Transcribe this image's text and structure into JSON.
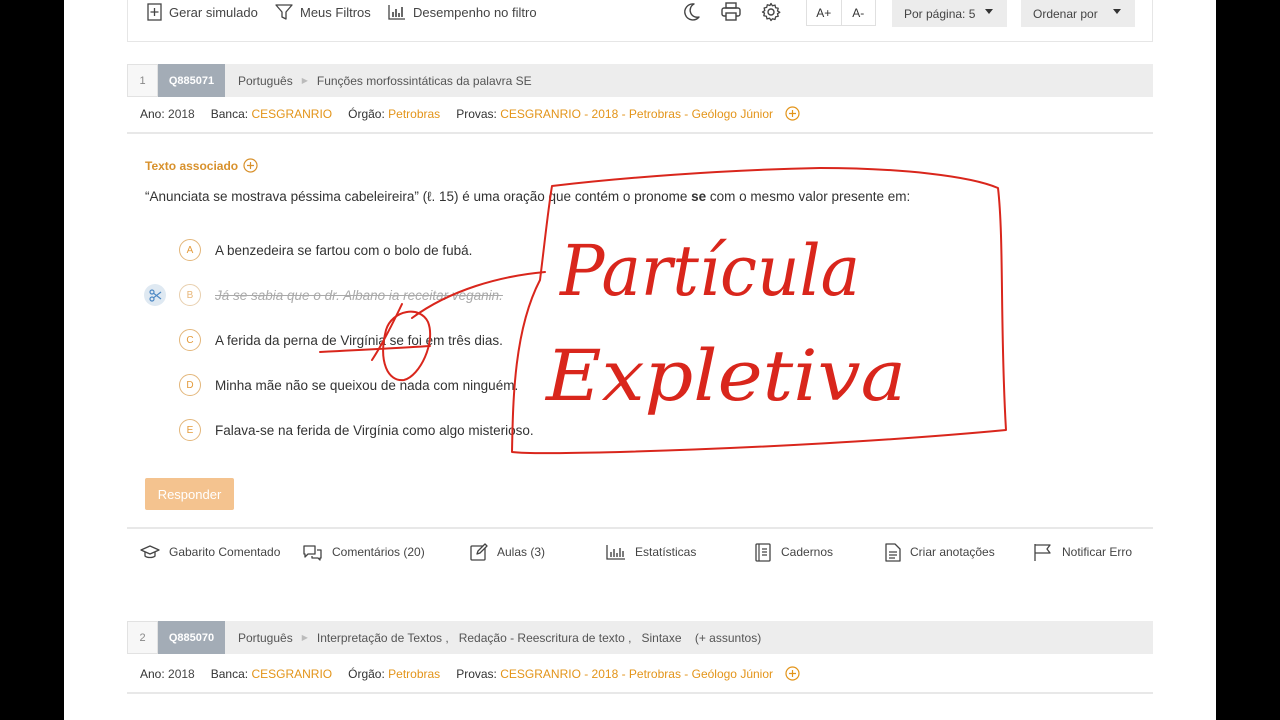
{
  "toolbar": {
    "gerar_simulado": "Gerar simulado",
    "meus_filtros": "Meus Filtros",
    "desempenho": "Desempenho no filtro",
    "font_increase": "A+",
    "font_decrease": "A-",
    "per_page": "Por página: 5",
    "order_by": "Ordenar por"
  },
  "question1": {
    "number": "1",
    "id": "Q885071",
    "subject": "Português",
    "topic": "Funções morfossintáticas da palavra SE",
    "meta": {
      "ano_label": "Ano:",
      "ano": "2018",
      "banca_label": "Banca:",
      "banca": "CESGRANRIO",
      "orgao_label": "Órgão:",
      "orgao": "Petrobras",
      "provas_label": "Provas:",
      "provas": "CESGRANRIO - 2018 - Petrobras - Geólogo Júnior"
    },
    "texto_associado": "Texto associado",
    "statement_part1": "“Anunciata se mostrava péssima cabeleireira” (ℓ. 15) é uma oração que contém o pronome ",
    "statement_bold": "se",
    "statement_part2": " com o mesmo valor presente em:",
    "alternatives": [
      {
        "letter": "A",
        "text": "A benzedeira se fartou com o bolo de fubá.",
        "cut": false
      },
      {
        "letter": "B",
        "text": "Já se sabia que o dr. Albano ia receitar veganin.",
        "cut": true
      },
      {
        "letter": "C",
        "text": "A ferida da perna de Virgínia se foi em três dias.",
        "cut": false
      },
      {
        "letter": "D",
        "text": "Minha mãe não se queixou de nada com ninguém.",
        "cut": false
      },
      {
        "letter": "E",
        "text": "Falava-se na ferida de Virgínia como algo misterioso.",
        "cut": false
      }
    ],
    "responder": "Responder"
  },
  "actions": {
    "gabarito": "Gabarito Comentado",
    "comentarios": "Comentários (20)",
    "aulas": "Aulas (3)",
    "estatisticas": "Estatísticas",
    "cadernos": "Cadernos",
    "anotacoes": "Criar anotações",
    "notificar": "Notificar Erro"
  },
  "question2": {
    "number": "2",
    "id": "Q885070",
    "subject": "Português",
    "topics": "Interpretação de Textos ,   Redação - Reescritura de texto ,   Sintaxe    (+ assuntos)",
    "meta": {
      "ano_label": "Ano:",
      "ano": "2018",
      "banca_label": "Banca:",
      "banca": "CESGRANRIO",
      "orgao_label": "Órgão:",
      "orgao": "Petrobras",
      "provas_label": "Provas:",
      "provas": "CESGRANRIO - 2018 - Petrobras - Geólogo Júnior"
    }
  },
  "annotation": {
    "line1": "Partícula",
    "line2": "Expletiva",
    "ink_color": "#d9261c"
  },
  "colors": {
    "accent": "#e39419",
    "id_badge": "#a3acb6",
    "button": "#f4c38f"
  }
}
